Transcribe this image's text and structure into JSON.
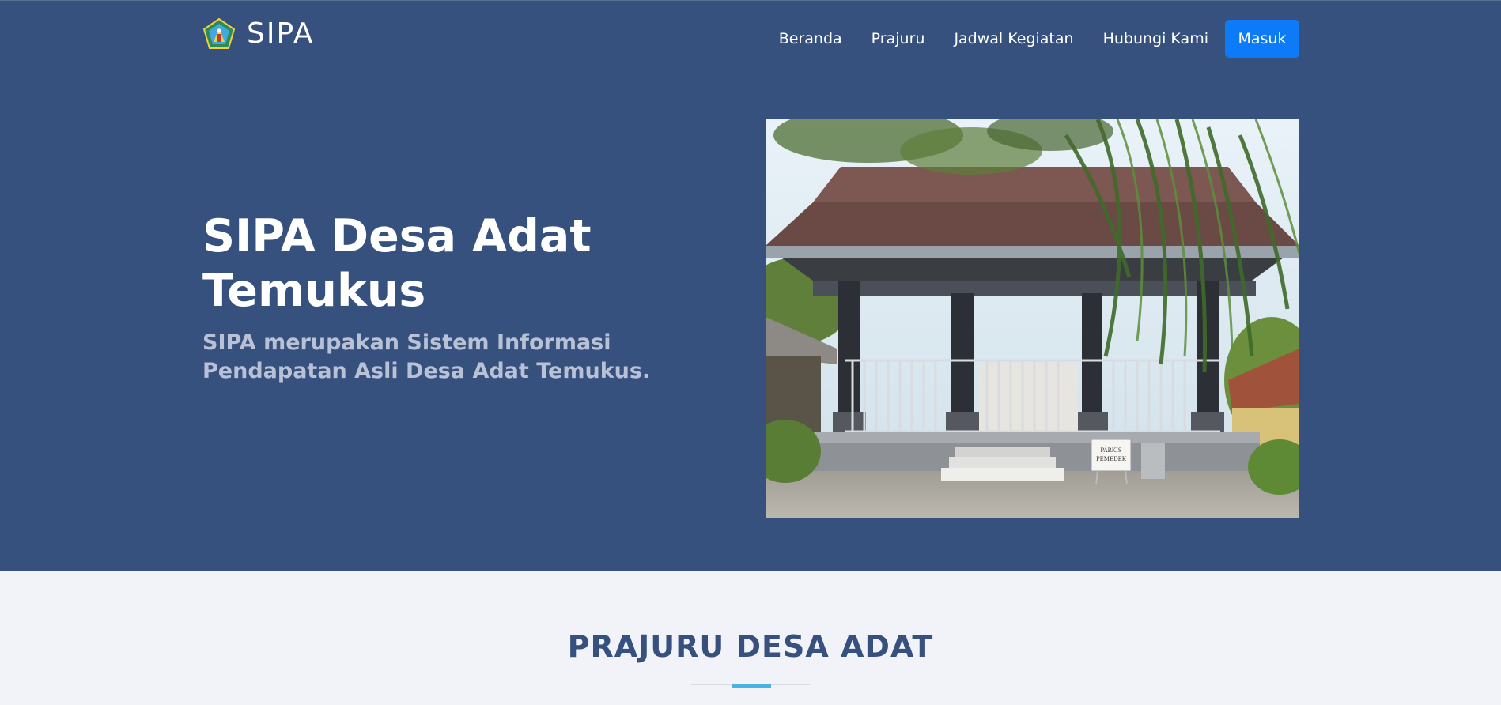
{
  "header": {
    "brand_name": "SIPA",
    "logo_icon": "desa-adat-emblem-icon",
    "nav": [
      {
        "label": "Beranda"
      },
      {
        "label": "Prajuru"
      },
      {
        "label": "Jadwal Kegiatan"
      },
      {
        "label": "Hubungi Kami"
      }
    ],
    "login_label": "Masuk"
  },
  "hero": {
    "title": "SIPA Desa Adat Temukus",
    "subtitle": "SIPA merupakan Sistem Informasi Pendapatan Asli Desa Adat Temukus.",
    "image_sign_text": "PARKIS PEMEDEK"
  },
  "section": {
    "title": "PRAJURU DESA ADAT"
  },
  "colors": {
    "hero_bg": "#37517e",
    "page_bg": "#f2f3f9",
    "primary_button": "#0d7bf7",
    "accent_line": "#47b2e4",
    "subtitle_text": "#b8c1d6"
  }
}
